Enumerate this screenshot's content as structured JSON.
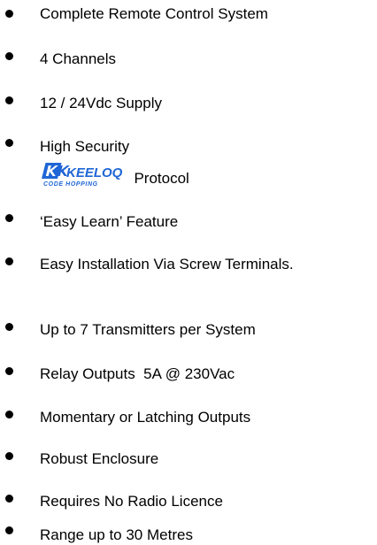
{
  "features": [
    {
      "label": "Complete Remote Control System"
    },
    {
      "label": "4 Channels"
    },
    {
      "label": "12 / 24Vdc Supply"
    },
    {
      "label": "High Security",
      "logo_text": "KEELOQ",
      "logo_subtext": "CODE HOPPING",
      "suffix": "Protocol"
    },
    {
      "label": "‘Easy Learn’ Feature"
    },
    {
      "label": "Easy Installation Via Screw Terminals."
    },
    {
      "label": "Up to 7 Transmitters per System"
    },
    {
      "label": "Relay Outputs  5A @ 230Vac"
    },
    {
      "label": "Momentary or Latching Outputs"
    },
    {
      "label": "Robust Enclosure"
    },
    {
      "label": "Requires No Radio Licence"
    },
    {
      "label": "Range up to 30 Metres"
    }
  ],
  "colors": {
    "text": "#000000",
    "logo_blue": "#1f66d6"
  },
  "icons": {
    "bullet": "filled-circle-bullet",
    "logo": "keeloq-logo-icon"
  }
}
